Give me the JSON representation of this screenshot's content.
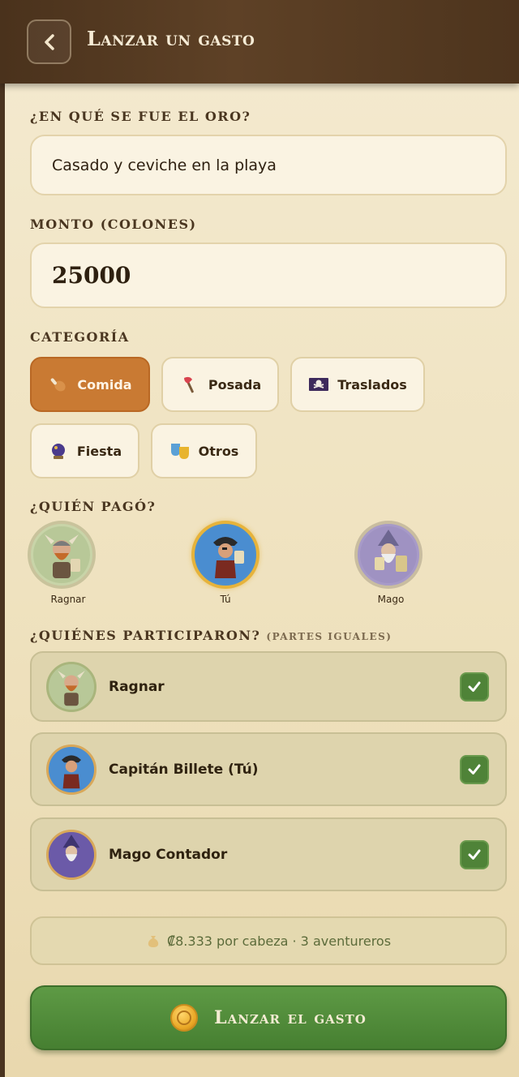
{
  "header": {
    "title": "Lanzar un gasto",
    "back_icon": "chevron-left-icon"
  },
  "description": {
    "label": "¿EN QUÉ SE FUE EL ORO?",
    "value": "Casado y ceviche en la playa"
  },
  "amount": {
    "label": "MONTO (COLONES)",
    "value": "25000"
  },
  "category": {
    "label": "CATEGORÍA",
    "items": [
      {
        "label": "Comida",
        "icon": "drumstick-icon",
        "selected": true
      },
      {
        "label": "Posada",
        "icon": "axe-icon",
        "selected": false
      },
      {
        "label": "Traslados",
        "icon": "pirate-flag-icon",
        "selected": false
      },
      {
        "label": "Fiesta",
        "icon": "crystal-ball-icon",
        "selected": false
      },
      {
        "label": "Otros",
        "icon": "theater-masks-icon",
        "selected": false
      }
    ]
  },
  "payer": {
    "label": "¿QUIÉN PAGÓ?",
    "items": [
      {
        "name": "Ragnar",
        "selected": false
      },
      {
        "name": "Tú",
        "selected": true
      },
      {
        "name": "Mago",
        "selected": false
      }
    ]
  },
  "participants": {
    "label": "¿QUIÉNES PARTICIPARON?",
    "sublabel": "(PARTES IGUALES)",
    "items": [
      {
        "name": "Ragnar",
        "checked": true
      },
      {
        "name": "Capitán Billete (Tú)",
        "checked": true
      },
      {
        "name": "Mago Contador",
        "checked": true
      }
    ]
  },
  "summary": {
    "text": "₡8.333 por cabeza · 3 aventureros"
  },
  "submit": {
    "label": "Lanzar el gasto"
  },
  "colors": {
    "accent": "#c97a33",
    "success": "#4f8338",
    "header": "#4a321c",
    "background": "#f4ead0"
  }
}
